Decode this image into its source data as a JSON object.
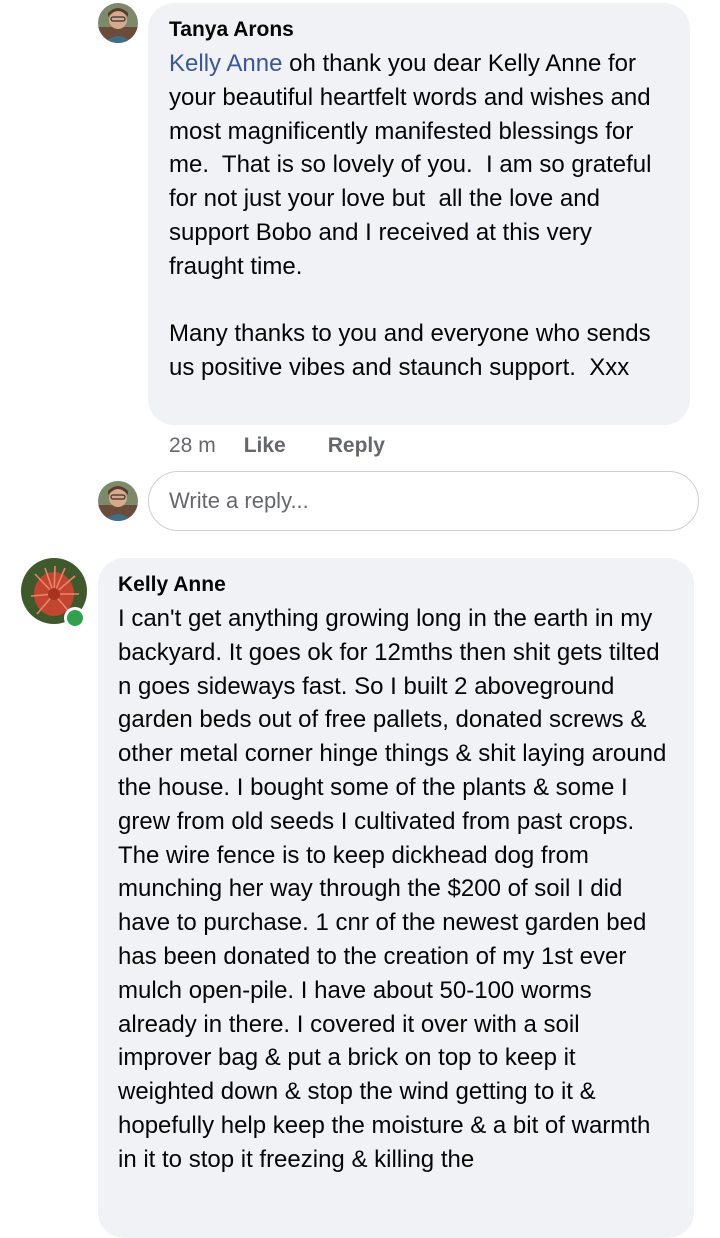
{
  "comments": [
    {
      "author": "Tanya Arons",
      "mention": "Kelly Anne",
      "text": " oh thank you dear Kelly Anne for your beautiful heartfelt words and wishes and most magnificently manifested blessings for me.  That is so lovely of you.  I am so grateful for not just your love but  all the love and support Bobo and I received at this very fraught time.\n\nMany thanks to you and everyone who sends us positive vibes and staunch support.  Xxx",
      "time": "28 m",
      "like_label": "Like",
      "reply_label": "Reply"
    },
    {
      "author": "Kelly Anne",
      "text": "I can't get anything growing long in the earth in my backyard. It goes ok for 12mths then shit gets tilted n goes sideways fast. So I built 2 aboveground garden beds out of free pallets, donated screws & other metal corner hinge things & shit laying around the house. I bought some of the plants & some I grew from old seeds I cultivated from past crops. The wire fence is to keep dickhead dog from munching her way through the $200 of soil I did have to purchase. 1 cnr of the newest garden bed has been donated to the creation of my 1st ever mulch open-pile. I have about 50-100 worms already in there. I covered it over with a soil improver bag & put a brick on top to keep it weighted down & stop the wind getting to it & hopefully help keep the moisture & a bit of warmth in it to stop it freezing & killing the",
      "online": true
    }
  ],
  "reply_input": {
    "placeholder": "Write a reply..."
  },
  "colors": {
    "bubble": "#f0f2f5",
    "mention": "#385898",
    "online": "#31a24c",
    "secondary_text": "#65676b"
  }
}
